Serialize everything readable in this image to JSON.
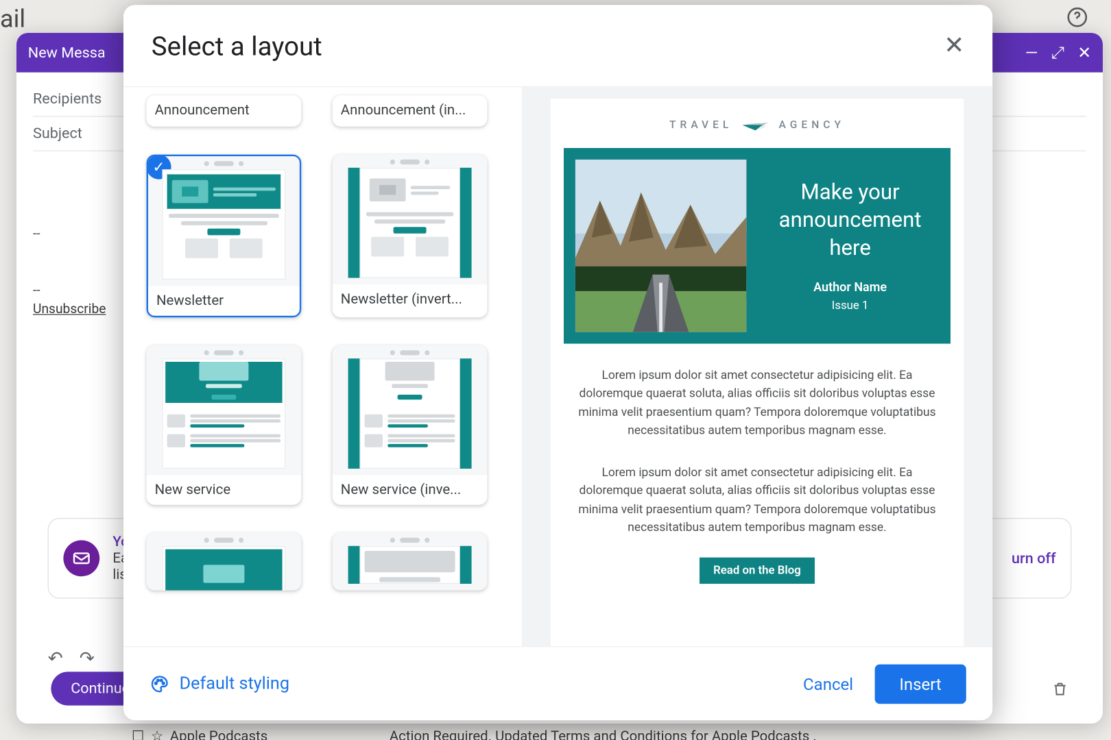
{
  "app": {
    "partial_brand_text": "ail"
  },
  "compose": {
    "title": "New Messa",
    "recipients_label": "Recipients",
    "subject_label": "Subject",
    "signature_dashes": "--",
    "unsubscribe": "Unsubscribe",
    "promo_headline": "Yo",
    "promo_sub": "Ea",
    "promo_sub2": "lis",
    "turn_off": "urn off",
    "continue": "Continue",
    "podcast_title": "Apple Podcasts",
    "podcast_action": "Action Required. Updated Terms and Conditions for Apple Podcasts ."
  },
  "dialog": {
    "title": "Select a layout",
    "styling": "Default styling",
    "cancel": "Cancel",
    "insert": "Insert"
  },
  "layouts": {
    "announcement": "Announcement",
    "announcement_inv": "Announcement (in...",
    "newsletter": "Newsletter",
    "newsletter_inv": "Newsletter (invert...",
    "new_service": "New service",
    "new_service_inv": "New service (inve..."
  },
  "preview": {
    "brand_left": "TRAVEL",
    "brand_right": "AGENCY",
    "headline": "Make your announcement here",
    "author": "Author Name",
    "issue": "Issue 1",
    "para1": "Lorem ipsum dolor sit amet consectetur adipisicing elit. Ea doloremque quaerat soluta, alias officiis sit doloribus voluptas esse minima velit praesentium quam? Tempora doloremque voluptatibus necessitatibus autem temporibus magnam esse.",
    "para2": "Lorem ipsum dolor sit amet consectetur adipisicing elit. Ea doloremque quaerat soluta, alias officiis sit doloribus voluptas esse minima velit praesentium quam? Tempora doloremque voluptatibus necessitatibus autem temporibus magnam esse.",
    "blog_btn": "Read on the Blog"
  }
}
